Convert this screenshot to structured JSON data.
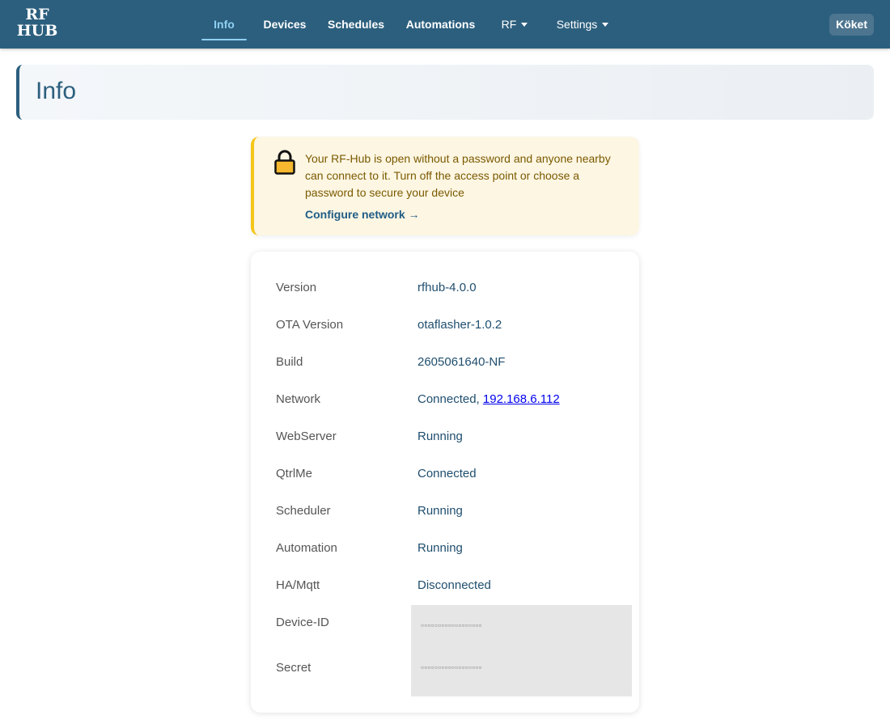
{
  "logo": {
    "line1": "RF",
    "line2": "HUB"
  },
  "nav": {
    "items": [
      {
        "label": "Info"
      },
      {
        "label": "Devices"
      },
      {
        "label": "Schedules"
      },
      {
        "label": "Automations"
      },
      {
        "label": "RF"
      },
      {
        "label": "Settings"
      }
    ],
    "active": "Info",
    "room_badge": "Köket"
  },
  "header": {
    "title": "Info"
  },
  "warning": {
    "icon": "lock-icon",
    "message": "Your RF-Hub is open without a password and anyone nearby can connect to it. Turn off the access point or choose a password to secure your device",
    "link_label": "Configure network →"
  },
  "info": {
    "rows": [
      {
        "label": "Version",
        "value": "rfhub-4.0.0"
      },
      {
        "label": "OTA Version",
        "value": "otaflasher-1.0.2"
      },
      {
        "label": "Build",
        "value": "2605061640-NF"
      },
      {
        "label": "Network",
        "value": "Connected, ",
        "link": "192.168.6.112"
      },
      {
        "label": "WebServer",
        "value": "Running"
      },
      {
        "label": "QtrlMe",
        "value": "Connected"
      },
      {
        "label": "Scheduler",
        "value": "Running"
      },
      {
        "label": "Automation",
        "value": "Running"
      },
      {
        "label": "HA/Mqtt",
        "value": "Disconnected"
      }
    ],
    "device_id": {
      "label": "Device-ID",
      "value": "▫▫▫▫▫▫▫▫▫▫▫▫▫▫▫▫▫▫"
    },
    "secret": {
      "label": "Secret",
      "value": "▫▫▫▫▫▫▫▫▫▫▫▫▫▫▫▫▫▫"
    }
  },
  "colors": {
    "navbar": "#2c5f7e",
    "active_nav": "#8fd0f2",
    "warning_border": "#f5c518",
    "value_text": "#1f4e6e"
  }
}
